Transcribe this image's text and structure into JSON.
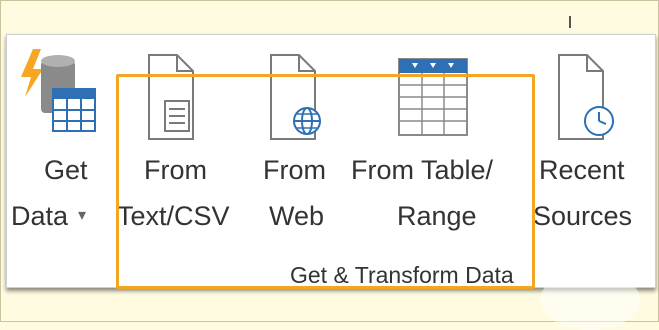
{
  "ribbon": {
    "group_label": "Get & Transform Data",
    "buttons": [
      {
        "line1": "Get",
        "line2": "Data",
        "dropdown": "▾",
        "icon": "database-table-icon"
      },
      {
        "line1": "From",
        "line2": "Text/CSV",
        "icon": "text-file-icon"
      },
      {
        "line1": "From",
        "line2": "Web",
        "icon": "web-file-icon"
      },
      {
        "line1": "From Table/",
        "line2": "Range",
        "icon": "table-range-icon"
      },
      {
        "line1": "Recent",
        "line2": "Sources",
        "icon": "recent-sources-icon"
      }
    ]
  },
  "colors": {
    "highlight": "#f2a623",
    "table_blue": "#2f6fb3",
    "bolt": "#f5a623"
  }
}
